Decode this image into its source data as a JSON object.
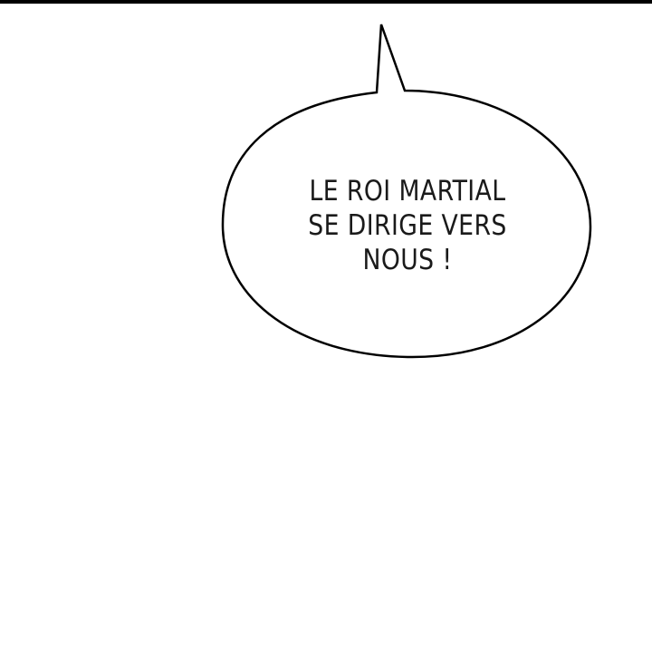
{
  "speech_bubble": {
    "lines": [
      "LE ROI MARTIAL",
      "SE DIRIGE VERS",
      "NOUS !"
    ]
  },
  "colors": {
    "background": "#ffffff",
    "outline": "#000000",
    "text": "#1a1a1a"
  }
}
